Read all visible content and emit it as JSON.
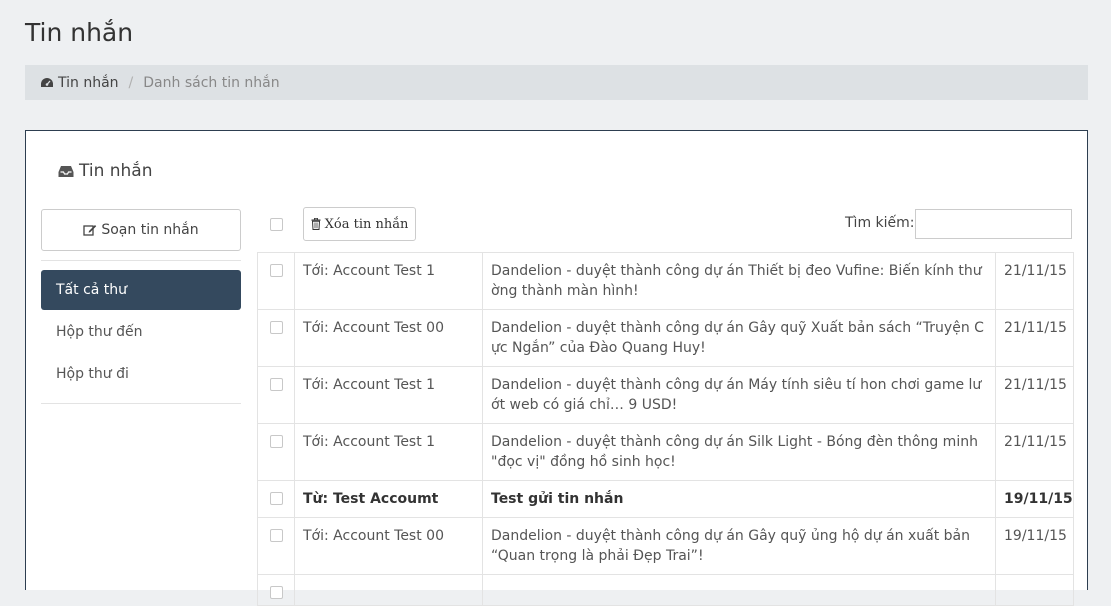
{
  "page": {
    "title": "Tin nhắn"
  },
  "breadcrumb": {
    "home_label": "Tin nhắn",
    "home_icon": "dashboard-icon",
    "current": "Danh sách tin nhắn"
  },
  "panel": {
    "title": "Tin nhắn",
    "title_icon": "inbox-icon"
  },
  "sidebar": {
    "compose_label": "Soạn tin nhắn",
    "compose_icon": "edit-icon",
    "items": [
      {
        "label": "Tất cả thư",
        "active": true
      },
      {
        "label": "Hộp thư đến",
        "active": false
      },
      {
        "label": "Hộp thư đi",
        "active": false
      }
    ]
  },
  "toolbar": {
    "delete_label": "Xóa tin nhắn",
    "delete_icon": "trash-icon"
  },
  "search": {
    "label": "Tìm kiếm:",
    "value": ""
  },
  "colors": {
    "accent": "#34495e",
    "panel_border": "#2d3e50",
    "background": "#eef0f2",
    "breadcrumb_bg": "#dde1e4"
  },
  "messages": [
    {
      "from": "Tới: Account Test 1",
      "subject": "Dandelion - duyệt thành công dự án Thiết bị đeo Vufine: Biến kính thường thành màn hình!",
      "date": "21/11/15",
      "unread": false
    },
    {
      "from": "Tới: Account Test 00",
      "subject": "Dandelion - duyệt thành công dự án Gây quỹ Xuất bản sách “Truyện Cực Ngắn” của Đào Quang Huy!",
      "date": "21/11/15",
      "unread": false
    },
    {
      "from": "Tới: Account Test 1",
      "subject": "Dandelion - duyệt thành công dự án Máy tính siêu tí hon chơi game lướt web có giá chỉ… 9 USD!",
      "date": "21/11/15",
      "unread": false
    },
    {
      "from": "Tới: Account Test 1",
      "subject": "Dandelion - duyệt thành công dự án Silk Light - Bóng đèn thông minh \"đọc vị\" đồng hồ sinh học!",
      "date": "21/11/15",
      "unread": false
    },
    {
      "from": "Từ: Test Accoumt",
      "subject": "Test gửi tin nhắn",
      "date": "19/11/15",
      "unread": true
    },
    {
      "from": "Tới: Account Test 00",
      "subject": "Dandelion - duyệt thành công dự án Gây quỹ ủng hộ dự án xuất bản “Quan trọng là phải Đẹp Trai”!",
      "date": "19/11/15",
      "unread": false
    },
    {
      "from": "",
      "subject": "",
      "date": "",
      "unread": false
    }
  ]
}
